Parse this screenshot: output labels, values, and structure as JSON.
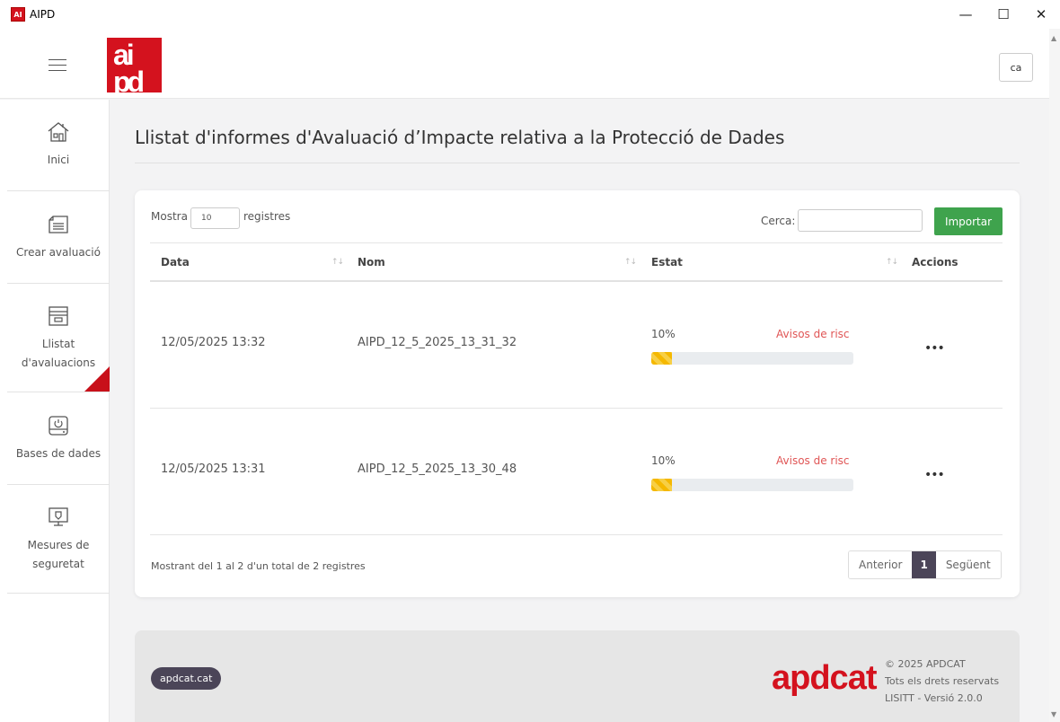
{
  "window": {
    "title": "AIPD",
    "icon_text": "AI",
    "minimize": "—",
    "maximize": "☐",
    "close": "✕"
  },
  "header": {
    "logo_text": "aipd",
    "language": "ca"
  },
  "sidebar": {
    "items": [
      {
        "label": "Inici",
        "icon": "home-icon"
      },
      {
        "label": "Crear avaluació",
        "icon": "new-document-icon"
      },
      {
        "label": "Llistat d'avaluacions",
        "icon": "folder-list-icon"
      },
      {
        "label": "Bases de dades",
        "icon": "database-icon"
      },
      {
        "label": "Mesures de seguretat",
        "icon": "security-monitor-icon"
      }
    ],
    "active_index": 2
  },
  "main": {
    "title": "Llistat d'informes d'Avaluació d’Impacte relativa a la Protecció de Dades",
    "show_label": "Mostra",
    "show_value": "10",
    "records_label": "registres",
    "search_label": "Cerca:",
    "search_value": "",
    "import_label": "Importar",
    "columns": [
      "Data",
      "Nom",
      "Estat",
      "Accions"
    ],
    "sort_glyph": "↑↓",
    "rows": [
      {
        "date": "12/05/2025 13:32",
        "name": "AIPD_12_5_2025_13_31_32",
        "progress_label": "10%",
        "progress": 0.1,
        "warning": "Avisos de risc",
        "actions": "•••"
      },
      {
        "date": "12/05/2025 13:31",
        "name": "AIPD_12_5_2025_13_30_48",
        "progress_label": "10%",
        "progress": 0.1,
        "warning": "Avisos de risc",
        "actions": "•••"
      }
    ],
    "info": "Mostrant del 1 al 2 d'un total de 2 registres",
    "pagination": {
      "prev": "Anterior",
      "current": "1",
      "next": "Següent"
    }
  },
  "footer": {
    "link": "apdcat.cat",
    "logo": "apdcat",
    "copyright": "© 2025 APDCAT",
    "rights": "Tots els drets reservats",
    "version": "LISITT - Versió 2.0.0"
  },
  "colors": {
    "brand_red": "#d4121e",
    "import_green": "#3fa34d",
    "progress_yellow": "#f5b800",
    "warning_red": "#e05555",
    "dark_purple": "#4b4558"
  }
}
